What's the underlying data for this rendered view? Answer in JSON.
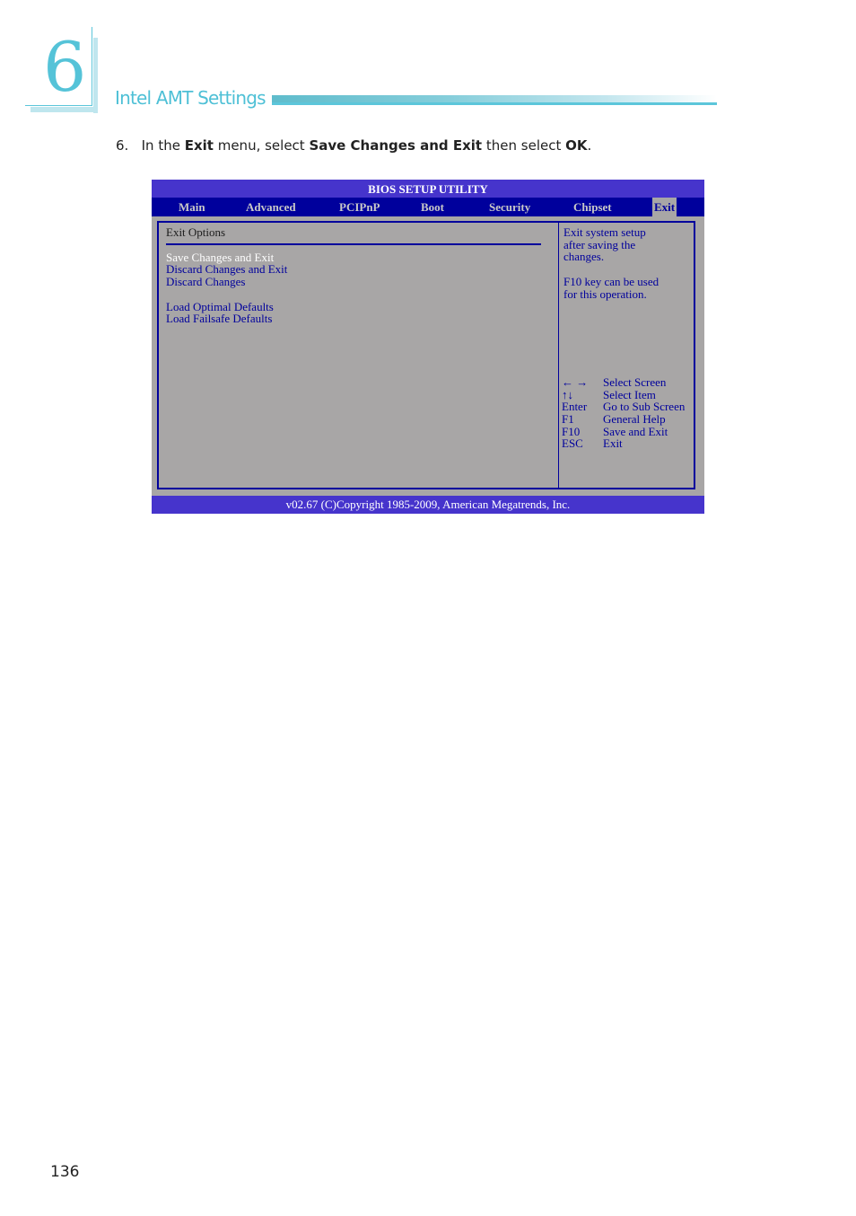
{
  "chapter": {
    "number": "6",
    "title": "Intel AMT Settings"
  },
  "instruction": {
    "step": "6.",
    "parts": [
      "In the ",
      "Exit",
      " menu, select ",
      "Save Changes and Exit",
      " then select ",
      "OK",
      "."
    ]
  },
  "bios": {
    "title": "BIOS SETUP UTILITY",
    "menu": [
      "Main",
      "Advanced",
      "PCIPnP",
      "Boot",
      "Security",
      "Chipset",
      "Exit"
    ],
    "active_menu": "Exit",
    "section_title": "Exit Options",
    "options_group1": [
      "Save Changes and Exit",
      "Discard Changes and Exit",
      "Discard Changes"
    ],
    "options_group2": [
      "Load Optimal Defaults",
      "Load Failsafe Defaults"
    ],
    "selected_option": "Save Changes and Exit",
    "help": {
      "lines1": [
        "Exit system setup",
        "after saving the",
        "changes."
      ],
      "lines2": [
        "F10 key can be used",
        "for this operation."
      ]
    },
    "keys": [
      {
        "key": "← →",
        "action": "Select Screen"
      },
      {
        "key": "↑↓",
        "action": "Select Item"
      },
      {
        "key": "Enter",
        "action": "Go to Sub Screen"
      },
      {
        "key": "F1",
        "action": "General Help"
      },
      {
        "key": "F10",
        "action": "Save and Exit"
      },
      {
        "key": "ESC",
        "action": "Exit"
      }
    ],
    "footer": "v02.67 (C)Copyright 1985-2009, American Megatrends, Inc.",
    "colors": {
      "title_bar": "#4634cc",
      "menu_bar": "#00009c",
      "panel_bg": "#a8a6a6",
      "option_text": "#00009c",
      "selected_text": "#ffffff"
    }
  },
  "page_number": "136"
}
